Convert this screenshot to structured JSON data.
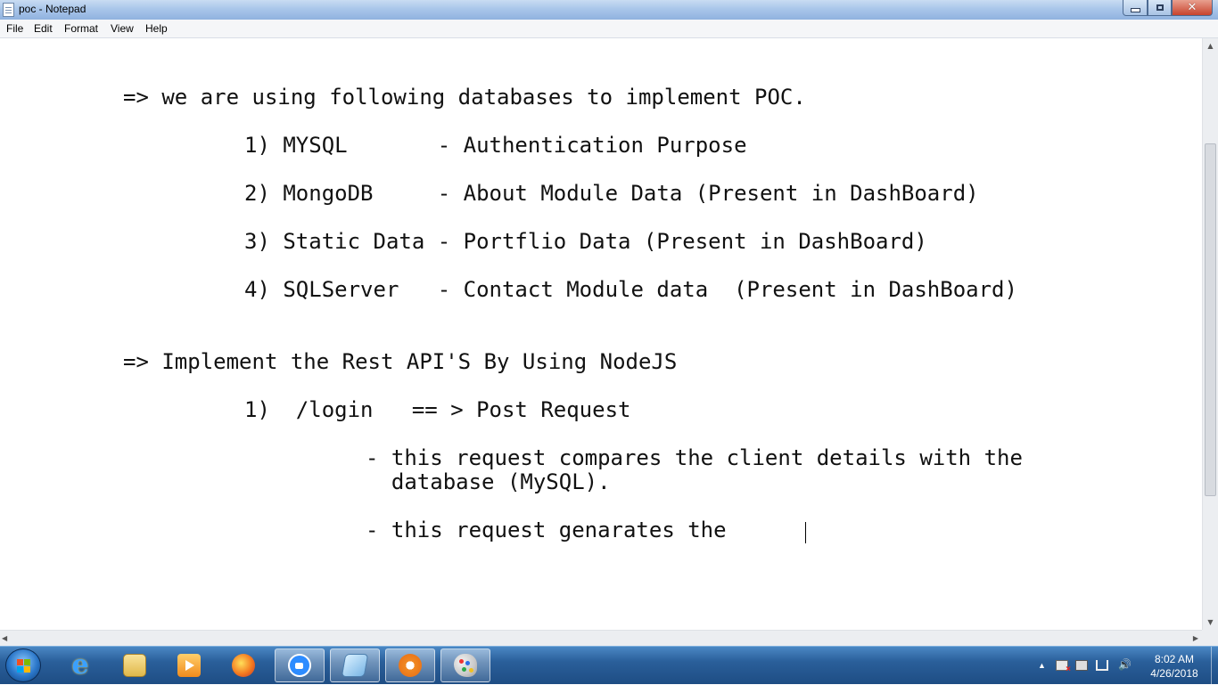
{
  "window": {
    "title": "poc - Notepad",
    "close_glyph": "✕"
  },
  "menu": {
    "items": [
      "File",
      "Edit",
      "Format",
      "View",
      "Help"
    ]
  },
  "editor": {
    "lines": [
      "=> we are using following databases to implement POC.",
      "1) MYSQL       - Authentication Purpose",
      "2) MongoDB     - About Module Data (Present in DashBoard)",
      "3) Static Data - Portflio Data (Present in DashBoard)",
      "4) SQLServer   - Contact Module data  (Present in DashBoard)",
      "=> Implement the Rest API'S By Using NodeJS",
      "1)  /login   == > Post Request",
      "- this request compares the client details with the",
      "  database (MySQL).",
      "- this request genarates the"
    ]
  },
  "scrollbars": {
    "up": "▲",
    "down": "▼",
    "left": "◀",
    "right": "▶"
  },
  "taskbar": {
    "ie_glyph": "e",
    "apps": [
      "start-icon",
      "ie-icon",
      "explorer-icon",
      "media-player-icon",
      "firefox-icon",
      "zoom-icon",
      "notepad-icon",
      "flower-app-icon",
      "paint-icon"
    ]
  },
  "tray": {
    "arrow": "▲",
    "volume": "🔊",
    "time": "8:02 AM",
    "date": "4/26/2018"
  }
}
